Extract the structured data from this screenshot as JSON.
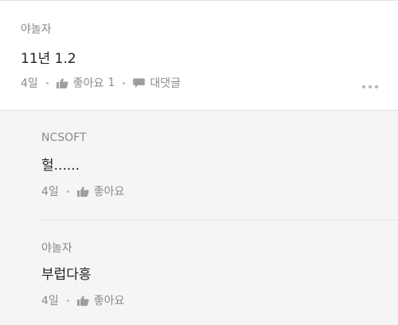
{
  "comment": {
    "author": "야놀자",
    "text": "11년 1.2",
    "time": "4일",
    "like_label": "좋아요",
    "like_count": "1",
    "reply_label": "대댓글"
  },
  "replies": [
    {
      "author": "NCSOFT",
      "text": "헐......",
      "time": "4일",
      "like_label": "좋아요"
    },
    {
      "author": "야놀자",
      "text": "부럽다흥",
      "time": "4일",
      "like_label": "좋아요"
    }
  ],
  "icons": {
    "like": "thumbs-up-icon",
    "reply": "speech-bubble-icon",
    "more": "more-dots-icon"
  },
  "colors": {
    "background": "#f5f5f5",
    "card": "#ffffff",
    "meta_text": "#8a8a8a",
    "body_text": "#222222",
    "icon": "#9e9e9e"
  }
}
